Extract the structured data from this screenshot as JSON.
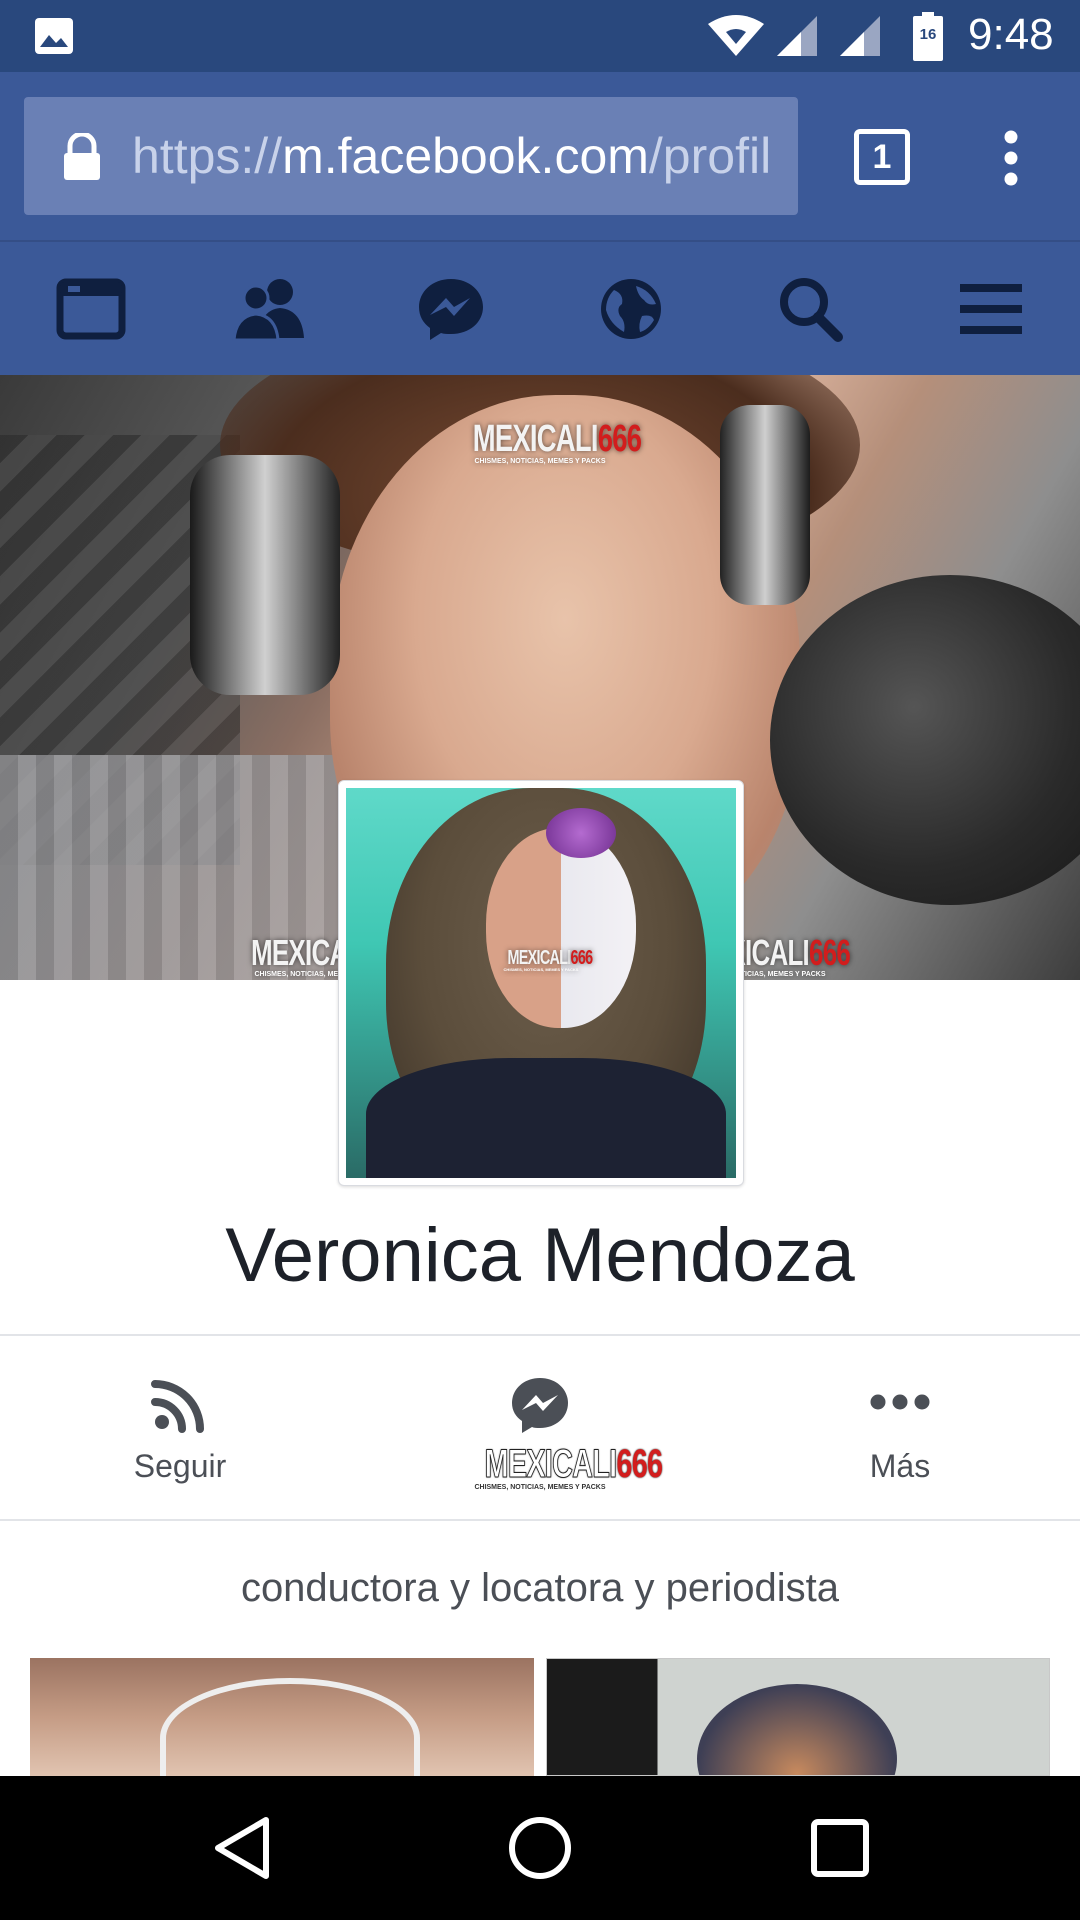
{
  "status_bar": {
    "time": "9:48",
    "battery_level": "16",
    "icons": [
      "gallery-icon",
      "wifi-icon",
      "signal-icon",
      "signal-icon",
      "battery-icon"
    ]
  },
  "browser": {
    "url_scheme": "https://",
    "url_host": "m.facebook.com",
    "url_path": "/profil",
    "tab_count": "1"
  },
  "fb_nav": {
    "items": [
      "news-feed-icon",
      "friends-icon",
      "messenger-icon",
      "notifications-globe-icon",
      "search-icon",
      "menu-icon"
    ]
  },
  "watermark": {
    "text_a": "MEXICALI",
    "text_b": "666",
    "subtitle": "CHISMES, NOTICIAS, MEMES Y PACKS"
  },
  "profile": {
    "name": "Veronica Mendoza",
    "bio": "conductora y locatora y periodista"
  },
  "actions": [
    {
      "label": "Seguir",
      "icon": "follow-rss-icon"
    },
    {
      "label": "",
      "icon": "messenger-icon"
    },
    {
      "label": "Más",
      "icon": "more-dots-icon"
    }
  ],
  "colors": {
    "fb_blue": "#3b5998",
    "status_bar": "#29487d",
    "url_field": "#6a80b5",
    "watermark_red": "#d21d1d"
  }
}
